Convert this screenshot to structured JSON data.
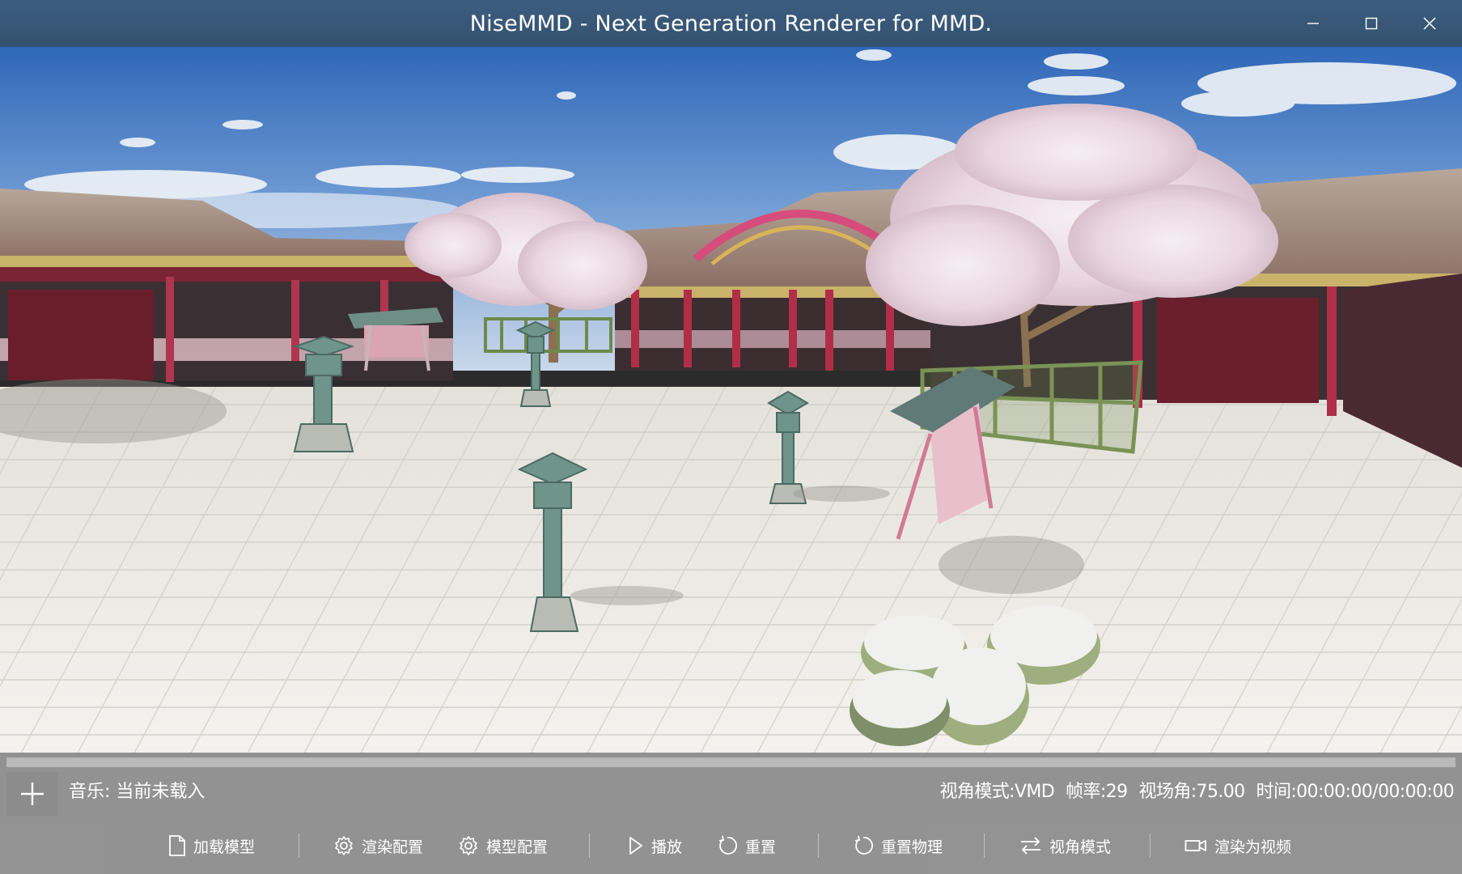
{
  "window": {
    "title": "NiseMMD - Next Generation Renderer for MMD.",
    "controls": [
      "minimize-icon",
      "maximize-icon",
      "close-icon"
    ]
  },
  "viewport": {
    "scene": "shrine-courtyard-with-cherry-blossoms"
  },
  "playback": {
    "progress": 0
  },
  "music": {
    "label": "音乐:",
    "status": "当前未载入"
  },
  "status_bar": {
    "camera_mode": "视角模式:VMD",
    "frame_rate": "帧率:29",
    "fov": "视场角:75.00",
    "time": "时间:00:00:00/00:00:00"
  },
  "toolbar": {
    "load_model": "加载模型",
    "render_config": "渲染配置",
    "model_config": "模型配置",
    "play": "播放",
    "reset": "重置",
    "reset_physics": "重置物理",
    "camera_mode": "视角模式",
    "render_video": "渲染为视频"
  },
  "icons": {
    "add": "plus-icon",
    "load_model": "file-icon",
    "render_config": "gear-icon",
    "model_config": "gear-icon",
    "play": "play-icon",
    "reset": "refresh-icon",
    "reset_physics": "refresh-icon",
    "camera_mode": "swap-arrows-icon",
    "render_video": "video-camera-icon"
  },
  "colors": {
    "titlebar": "#3a5878",
    "panel": "#969696",
    "sky": "#4f7fbf",
    "ground": "#eeece8",
    "building_red": "#8c2a3c",
    "blossom": "#efdfe7"
  }
}
